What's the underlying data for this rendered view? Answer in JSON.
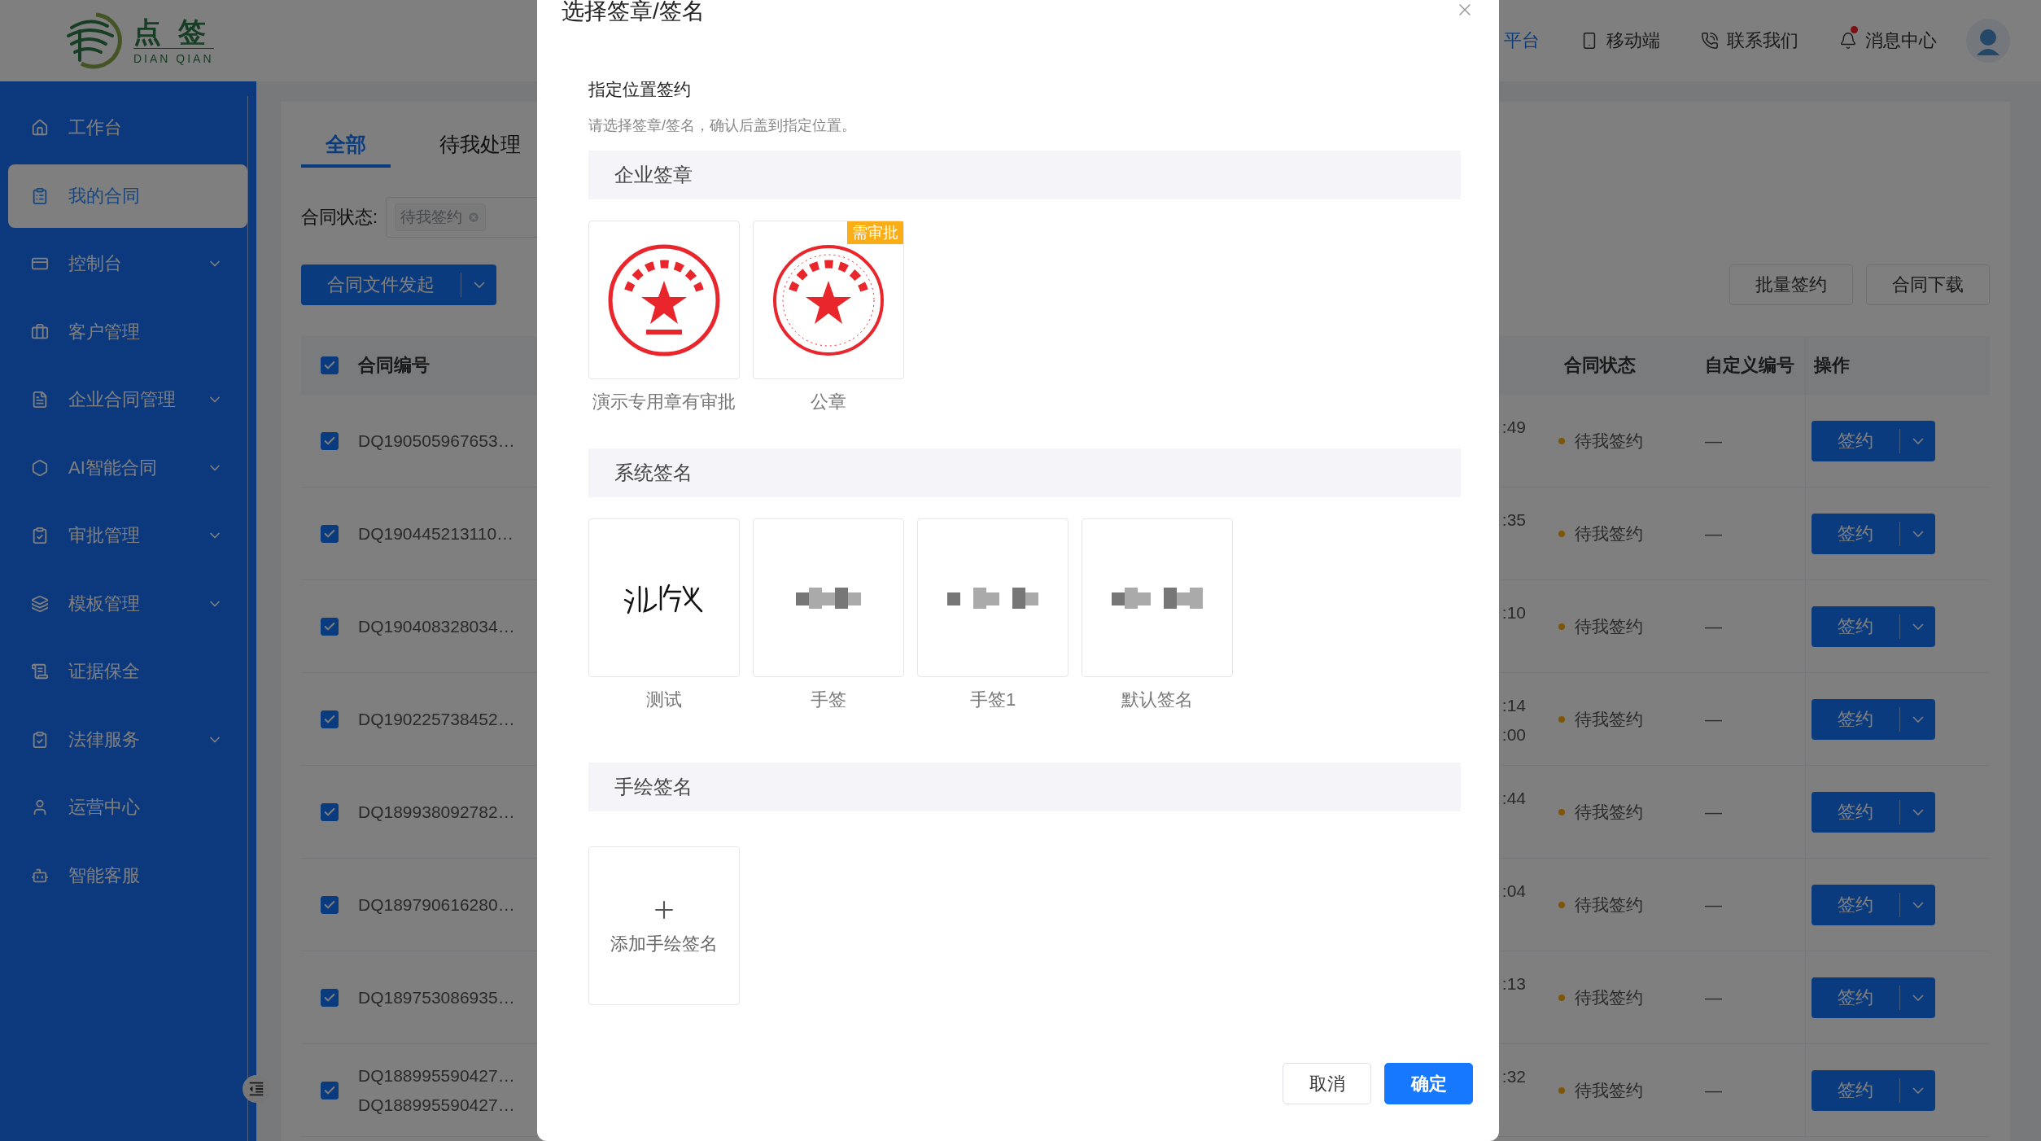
{
  "header": {
    "logo": {
      "name": "点 签",
      "subtitle": "DIAN QIAN"
    },
    "nav": [
      {
        "label": "平台",
        "selected": true,
        "unread": false
      },
      {
        "label": "移动端",
        "selected": false,
        "unread": false
      },
      {
        "label": "联系我们",
        "selected": false,
        "unread": false
      },
      {
        "label": "消息中心",
        "selected": false,
        "unread": true
      }
    ]
  },
  "sidebar": {
    "items": [
      {
        "label": "工作台",
        "selected": false,
        "expandable": false
      },
      {
        "label": "我的合同",
        "selected": true,
        "expandable": false
      },
      {
        "label": "控制台",
        "selected": false,
        "expandable": true
      },
      {
        "label": "客户管理",
        "selected": false,
        "expandable": false
      },
      {
        "label": "企业合同管理",
        "selected": false,
        "expandable": true
      },
      {
        "label": "AI智能合同",
        "selected": false,
        "expandable": true
      },
      {
        "label": "审批管理",
        "selected": false,
        "expandable": true
      },
      {
        "label": "模板管理",
        "selected": false,
        "expandable": true
      },
      {
        "label": "证据保全",
        "selected": false,
        "expandable": false
      },
      {
        "label": "法律服务",
        "selected": false,
        "expandable": true
      },
      {
        "label": "运营中心",
        "selected": false,
        "expandable": false
      },
      {
        "label": "智能客服",
        "selected": false,
        "expandable": false
      }
    ]
  },
  "tabs": [
    {
      "label": "全部",
      "selected": true
    },
    {
      "label": "待我处理",
      "selected": false
    }
  ],
  "filter": {
    "label": "合同状态:",
    "tags": [
      "待我签约"
    ]
  },
  "toolbar": {
    "primary": "合同文件发起",
    "buttons": [
      "批量签约",
      "合同下载"
    ]
  },
  "table": {
    "all_checked": true,
    "columns": {
      "number": "合同编号",
      "status": "合同状态",
      "custom_no": "自定义编号",
      "actions": "操作"
    },
    "rows": [
      {
        "checked": true,
        "numbers": [
          "DQ190505967653…"
        ],
        "time": [
          ":49"
        ],
        "status": "待我签约",
        "custom_no": "—",
        "action": "签约"
      },
      {
        "checked": true,
        "numbers": [
          "DQ190445213110…"
        ],
        "time": [
          ":35"
        ],
        "status": "待我签约",
        "custom_no": "—",
        "action": "签约"
      },
      {
        "checked": true,
        "numbers": [
          "DQ190408328034…"
        ],
        "time": [
          ":10"
        ],
        "status": "待我签约",
        "custom_no": "—",
        "action": "签约"
      },
      {
        "checked": true,
        "numbers": [
          "DQ190225738452…"
        ],
        "time": [
          ":14",
          ":00"
        ],
        "status": "待我签约",
        "custom_no": "—",
        "action": "签约"
      },
      {
        "checked": true,
        "numbers": [
          "DQ189938092782…"
        ],
        "time": [
          ":44"
        ],
        "status": "待我签约",
        "custom_no": "—",
        "action": "签约"
      },
      {
        "checked": true,
        "numbers": [
          "DQ189790616280…"
        ],
        "time": [
          ":04"
        ],
        "status": "待我签约",
        "custom_no": "—",
        "action": "签约"
      },
      {
        "checked": true,
        "numbers": [
          "DQ189753086935…"
        ],
        "time": [
          ":13"
        ],
        "status": "待我签约",
        "custom_no": "—",
        "action": "签约"
      },
      {
        "checked": true,
        "numbers": [
          "DQ188995590427…",
          "DQ188995590427…"
        ],
        "time": [
          ":32"
        ],
        "status": "待我签约",
        "custom_no": "—",
        "action": "签约"
      }
    ]
  },
  "dialog": {
    "title": "选择签章/签名",
    "heading": "指定位置签约",
    "hint": "请选择签章/签名，确认后盖到指定位置。",
    "sections": [
      {
        "title": "企业签章",
        "items": [
          {
            "kind": "stamp",
            "label": "演示专用章有审批"
          },
          {
            "kind": "stamp",
            "label": "公章",
            "badge": "需审批"
          }
        ]
      },
      {
        "title": "系统签名",
        "items": [
          {
            "kind": "signature",
            "label": "测试"
          },
          {
            "kind": "blurred",
            "label": "手签"
          },
          {
            "kind": "blurred",
            "label": "手签1"
          },
          {
            "kind": "blurred",
            "label": "默认签名"
          }
        ]
      },
      {
        "title": "手绘签名",
        "items": [
          {
            "kind": "add",
            "label": "添加手绘签名"
          }
        ]
      }
    ],
    "buttons": [
      {
        "label": "取消",
        "primary": false
      },
      {
        "label": "确定",
        "primary": true
      }
    ]
  }
}
